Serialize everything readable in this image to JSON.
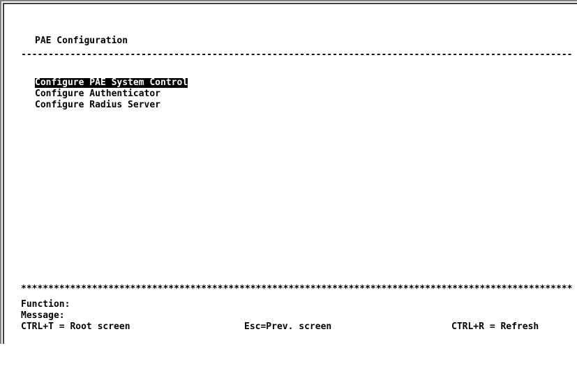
{
  "screen": {
    "title": "PAE Configuration",
    "divider": "---------------------------------------------------------------------------------------------------------------------",
    "menu": [
      {
        "label": "Configure PAE System Control",
        "selected": true
      },
      {
        "label": "Configure Authenticator",
        "selected": false
      },
      {
        "label": "Configure Radius Server",
        "selected": false
      }
    ]
  },
  "footer": {
    "stars": "*****************************************************************************************************************",
    "function_label": "Function:",
    "message_label": "Message:",
    "hints": {
      "root": "CTRL+T = Root screen",
      "prev": "Esc=Prev. screen",
      "refresh": "CTRL+R = Refresh"
    }
  }
}
